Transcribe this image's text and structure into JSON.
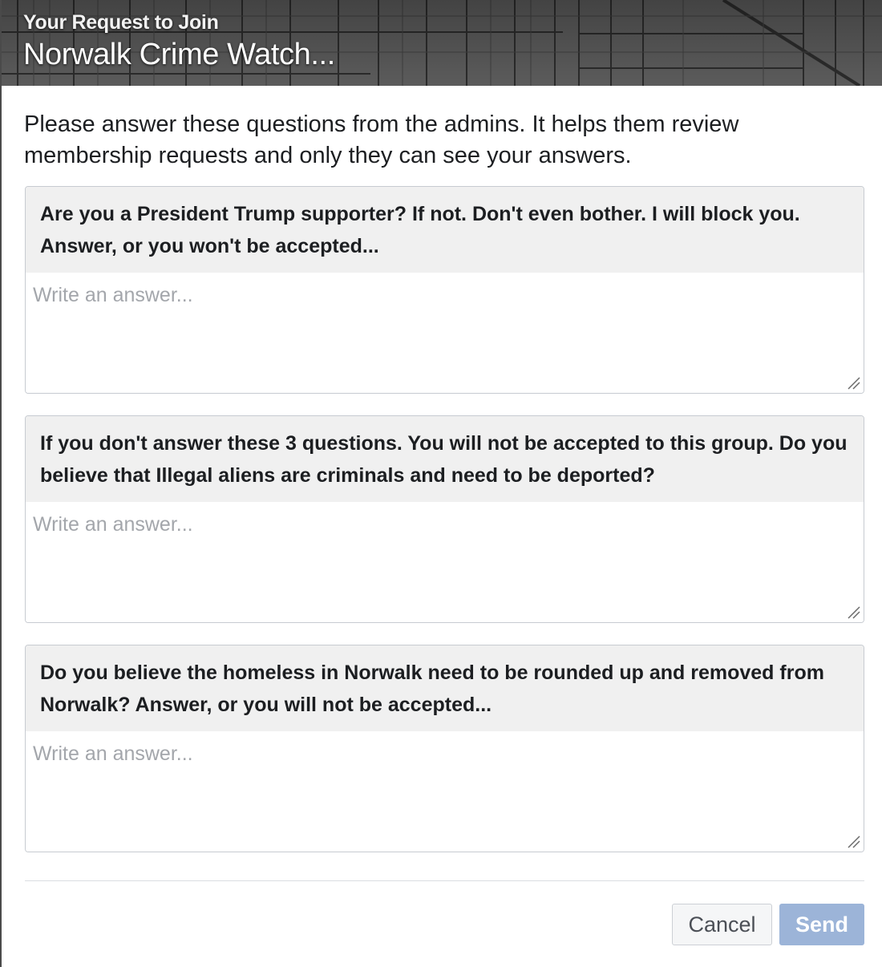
{
  "header": {
    "subtitle": "Your Request to Join",
    "title": "Norwalk Crime Watch..."
  },
  "intro": "Please answer these questions from the admins. It helps them review membership requests and only they can see your answers.",
  "questions": [
    {
      "text": "Are you a President Trump supporter? If not. Don't even bother. I will block you. Answer, or you won't be accepted...",
      "answer": "",
      "placeholder": "Write an answer..."
    },
    {
      "text": "If you don't answer these 3 questions. You will not be accepted to this group. Do you believe that Illegal aliens are criminals and need to be deported?",
      "answer": "",
      "placeholder": "Write an answer..."
    },
    {
      "text": "Do you believe the homeless in Norwalk need to be rounded up and removed from Norwalk? Answer, or you will not be accepted...",
      "answer": "",
      "placeholder": "Write an answer..."
    }
  ],
  "footer": {
    "cancel_label": "Cancel",
    "send_label": "Send"
  },
  "colors": {
    "send_disabled": "#9cb4d8",
    "question_bg": "#f0f0f0",
    "border": "#c7cbd1"
  }
}
